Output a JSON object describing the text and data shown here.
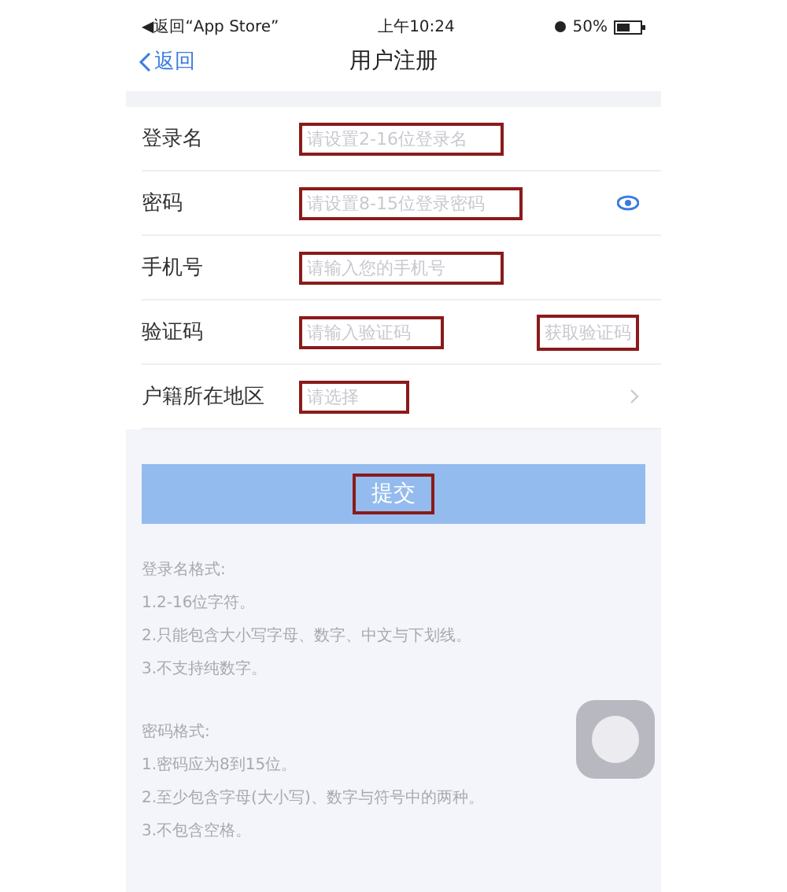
{
  "status_bar": {
    "back_app": "◀返回“App Store”",
    "time": "上午10:24",
    "battery": "50%"
  },
  "nav": {
    "back": "返回",
    "title": "用户注册"
  },
  "fields": [
    {
      "kind": "input",
      "label": "登录名",
      "placeholder": "请设置2-16位登录名",
      "annotated": true
    },
    {
      "kind": "password",
      "label": "密码",
      "placeholder": "请设置8-15位登录密码",
      "annotated": true
    },
    {
      "kind": "input",
      "label": "手机号",
      "placeholder": "请输入您的手机号",
      "annotated": true
    },
    {
      "kind": "code",
      "label": "验证码",
      "placeholder": "请输入验证码",
      "annotated": true,
      "action": "获取验证码",
      "action_annotated": true
    },
    {
      "kind": "select",
      "label": "户籍所在地区",
      "placeholder": "请选择",
      "annotated": true
    }
  ],
  "submit": {
    "label": "提交",
    "annotated": true
  },
  "notes": [
    {
      "title": "登录名格式:",
      "lines": [
        "1.2-16位字符。",
        "2.只能包含大小写字母、数字、中文与下划线。",
        "3.不支持纯数字。"
      ]
    },
    {
      "title": "密码格式:",
      "lines": [
        "1.密码应为8到15位。",
        "2.至少包含字母(大小写)、数字与符号中的两种。",
        "3.不包含空格。"
      ]
    }
  ]
}
